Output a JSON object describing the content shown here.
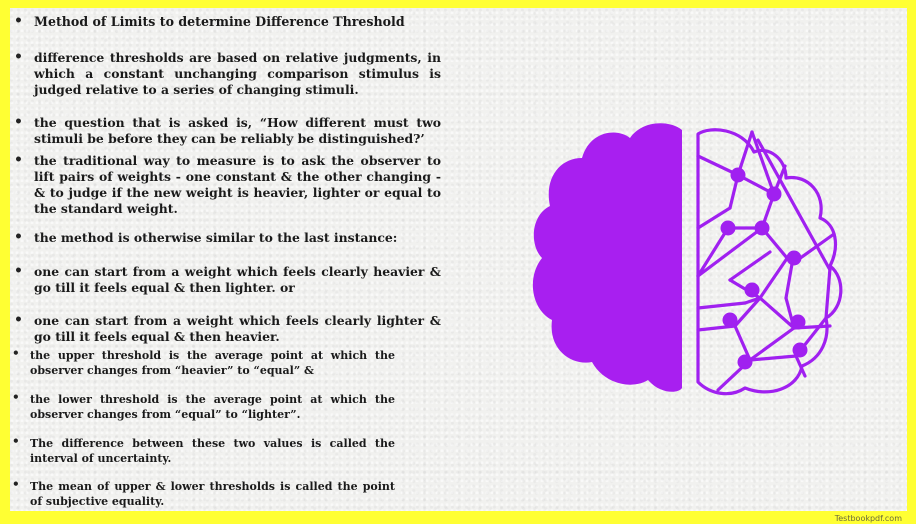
{
  "slide": {
    "title": "Method of Limits to determine Difference Threshold",
    "bullets": [
      {
        "text": "difference thresholds are based on relative judgments, in which a constant unchanging comparison stimulus is judged relative to a series of changing stimuli."
      },
      {
        "text": "the question that is asked is, “How different must two stimuli be before they can be reliably be distinguished?’"
      },
      {
        "text": "the traditional way to measure is to ask the observer to lift pairs of weights - one constant & the other changing - & to judge if the new weight is heavier, lighter or equal to the standard weight."
      },
      {
        "text": "the method is otherwise similar to the last instance:"
      },
      {
        "text": "one can start from a weight which feels clearly heavier & go till it feels equal & then lighter. or"
      },
      {
        "text": "one can start from a weight which feels clearly lighter & go till it feels equal & then heavier."
      },
      {
        "text": "the upper threshold is the average point at which the observer changes from “heavier” to “equal” &"
      },
      {
        "text": "the lower threshold is the average point at which the observer changes from “equal” to “lighter”."
      },
      {
        "text": "The difference between these two values is called the",
        "emphasis": "interval of uncertainty."
      },
      {
        "text": "The mean of upper & lower thresholds is called the",
        "emphasis": "point of subjective equality."
      }
    ],
    "bullet_symbol": "•"
  },
  "illustration": {
    "icon": "brain-circuit-icon",
    "color": "#a020f0"
  },
  "colors": {
    "frame": "#ffff33",
    "paper": "#f1f1ef",
    "text": "#1a1a1a"
  },
  "footer": {
    "watermark": "Testbookpdf.com"
  }
}
